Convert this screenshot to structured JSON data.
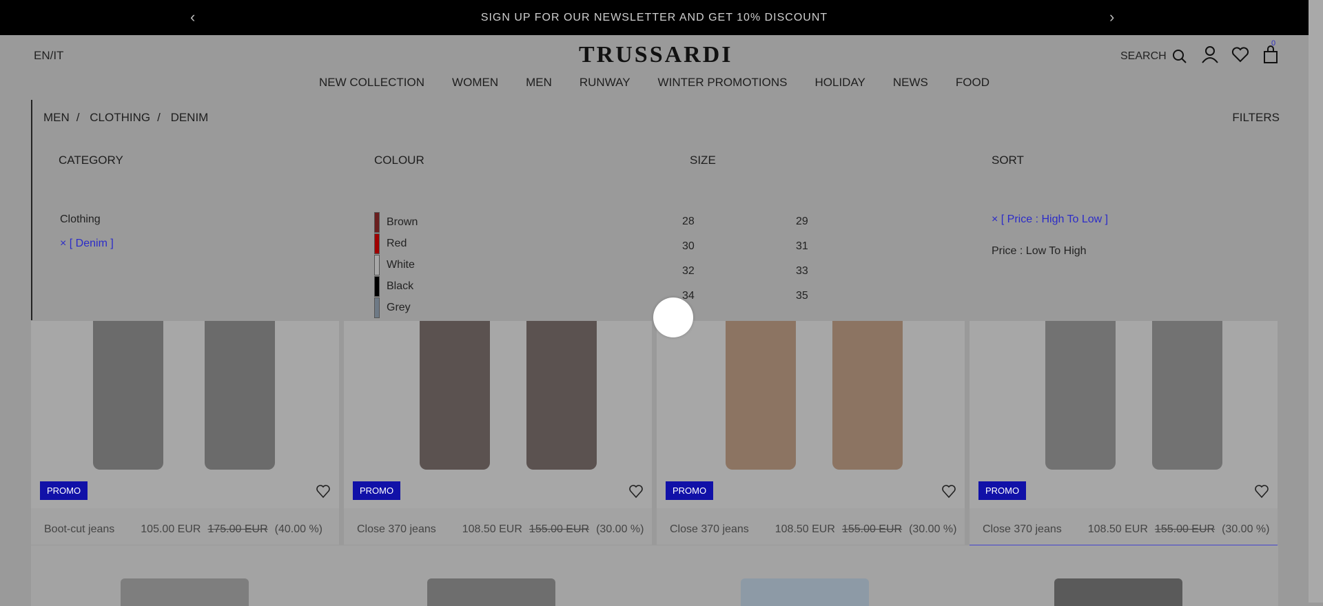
{
  "promo_bar": {
    "text": "SIGN UP FOR OUR NEWSLETTER AND GET 10% DISCOUNT",
    "left_arrow": "‹",
    "right_arrow": "›"
  },
  "header": {
    "language": "EN/IT",
    "logo": "TRUSSARDI",
    "search_label": "SEARCH",
    "cart_count": "0",
    "nav": [
      "NEW COLLECTION",
      "WOMEN",
      "MEN",
      "RUNWAY",
      "WINTER PROMOTIONS",
      "HOLIDAY",
      "NEWS",
      "FOOD"
    ]
  },
  "breadcrumb": [
    "MEN",
    "CLOTHING",
    "DENIM"
  ],
  "filters_label": "FILTERS",
  "filter_columns": {
    "category": "CATEGORY",
    "colour": "COLOUR",
    "size": "SIZE",
    "sort": "SORT"
  },
  "category": {
    "parent": "Clothing",
    "active": "× [ Denim ]"
  },
  "colours": [
    {
      "name": "Brown",
      "hex": "#6a1f1f"
    },
    {
      "name": "Red",
      "hex": "#a00000"
    },
    {
      "name": "White",
      "hex": "#a8a8a8"
    },
    {
      "name": "Black",
      "hex": "#000000"
    },
    {
      "name": "Grey",
      "hex": "#6e7a86"
    }
  ],
  "sizes": [
    "28",
    "29",
    "30",
    "31",
    "32",
    "33",
    "34",
    "35"
  ],
  "sort": {
    "active": "× [ Price : High To Low ]",
    "other": "Price : Low To High"
  },
  "products": [
    {
      "badge": "PROMO",
      "name": "Boot-cut jeans",
      "price": "105.00 EUR",
      "old_price": "175.00 EUR",
      "discount": "(40.00 %)",
      "leg_color": "#6b6b6b"
    },
    {
      "badge": "PROMO",
      "name": "Close 370 jeans",
      "price": "108.50 EUR",
      "old_price": "155.00 EUR",
      "discount": "(30.00 %)",
      "leg_color": "#5b5250"
    },
    {
      "badge": "PROMO",
      "name": "Close 370 jeans",
      "price": "108.50 EUR",
      "old_price": "155.00 EUR",
      "discount": "(30.00 %)",
      "leg_color": "#8c7462"
    },
    {
      "badge": "PROMO",
      "name": "Close 370 jeans",
      "price": "108.50 EUR",
      "old_price": "155.00 EUR",
      "discount": "(30.00 %)",
      "leg_color": "#727272"
    }
  ],
  "thumb_colors": [
    "#7e7e7e",
    "#6e6e6e",
    "#8d9aa6",
    "#5a5a5a"
  ]
}
